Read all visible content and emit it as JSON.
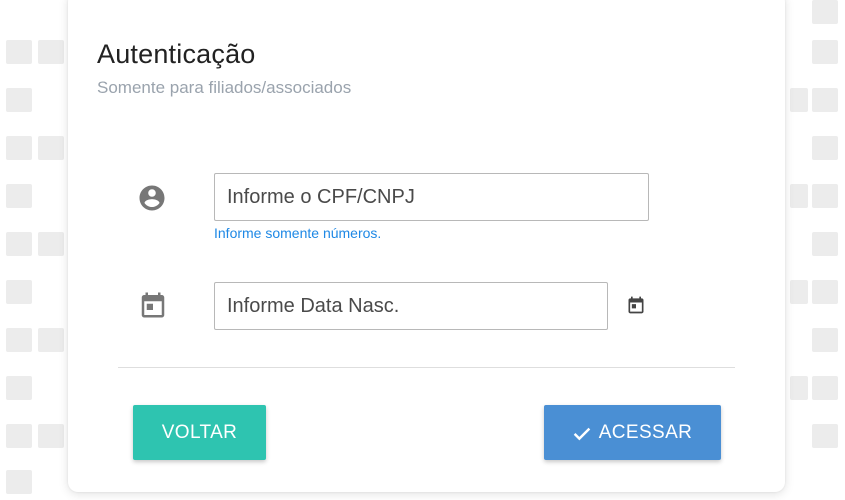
{
  "auth": {
    "title": "Autenticação",
    "subtitle": "Somente para filiados/associados"
  },
  "form": {
    "cpf": {
      "placeholder": "Informe o CPF/CNPJ",
      "value": "",
      "icon": "account-circle-icon",
      "hint": "Informe somente números."
    },
    "birthdate": {
      "placeholder": "Informe Data Nasc.",
      "value": "",
      "icon": "calendar-icon",
      "picker_icon": "calendar-icon"
    }
  },
  "actions": {
    "back_label": "VOLTAR",
    "access_label": "ACESSAR",
    "access_icon": "check-icon"
  },
  "colors": {
    "back_button": "#2ec4b0",
    "access_button": "#4a8fd4",
    "hint_text": "#1e88e5",
    "subtitle_text": "#9aa3ad"
  }
}
